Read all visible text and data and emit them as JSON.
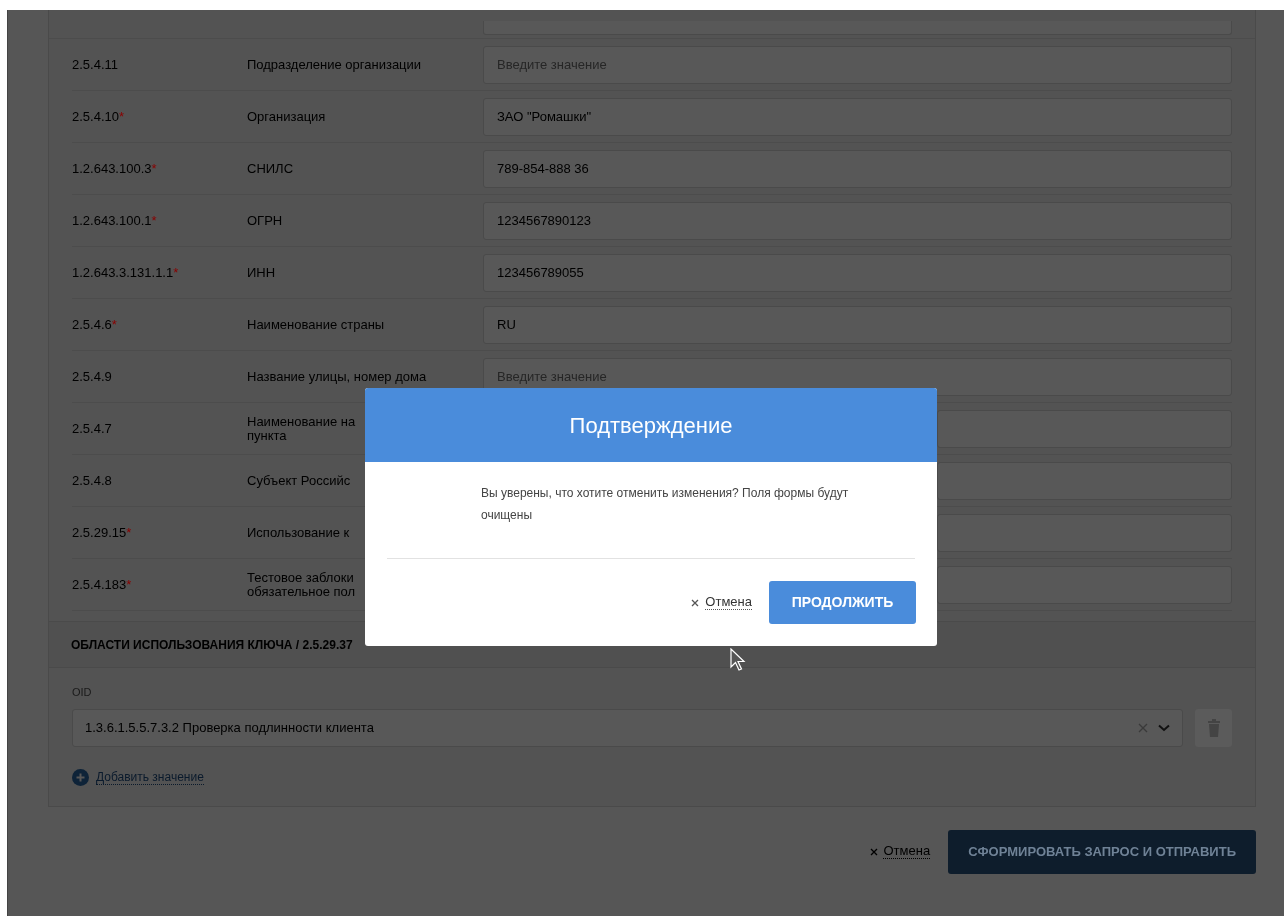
{
  "form_rows": [
    {
      "oid": "2.5.4.11",
      "label_lines": [
        "Подразделение организации"
      ],
      "field": {
        "placeholder": "Введите значение"
      }
    },
    {
      "oid": "2.5.4.10",
      "required_mark": "*",
      "label_lines": [
        "Организация"
      ],
      "field": {
        "value": "ЗАО \"Ромашки\""
      }
    },
    {
      "oid": "1.2.643.100.3",
      "required_mark": "*",
      "label_lines": [
        "СНИЛС"
      ],
      "field": {
        "value": "789-854-888 36"
      }
    },
    {
      "oid": "1.2.643.100.1",
      "required_mark": "*",
      "label_lines": [
        "ОГРН"
      ],
      "field": {
        "value": "1234567890123"
      }
    },
    {
      "oid": "1.2.643.3.131.1.1",
      "required_mark": "*",
      "label_lines": [
        "ИНН"
      ],
      "field": {
        "value": "123456789055"
      }
    },
    {
      "oid": "2.5.4.6",
      "required_mark": "*",
      "label_lines": [
        "Наименование страны"
      ],
      "field": {
        "value": "RU"
      }
    },
    {
      "oid": "2.5.4.9",
      "label_lines": [
        "Название улицы, номер дома"
      ],
      "field": {
        "placeholder": "Введите значение"
      }
    },
    {
      "oid": "2.5.4.7",
      "label_lines": [
        "Наименование на",
        "пункта"
      ]
    },
    {
      "oid": "2.5.4.8",
      "label_lines": [
        "Субъект Российс"
      ]
    },
    {
      "oid": "2.5.29.15",
      "required_mark": "*",
      "label_lines": [
        "Использование к"
      ]
    },
    {
      "oid": "2.5.4.183",
      "required_mark": "*",
      "label_lines": [
        "Тестовое заблоки",
        "обязательное пол"
      ]
    }
  ],
  "section": {
    "title": "ОБЛАСТИ ИСПОЛЬЗОВАНИЯ КЛЮЧА / 2.5.29.37"
  },
  "oid_field": {
    "label": "OID",
    "value": "1.3.6.1.5.5.7.3.2 Проверка подлинности клиента"
  },
  "add_link": "Добавить значение",
  "footer": {
    "cancel": "Отмена",
    "submit": "СФОРМИРОВАТЬ ЗАПРОС И ОТПРАВИТЬ"
  },
  "dialog": {
    "title": "Подтверждение",
    "message": "Вы уверены, что хотите отменить изменения? Поля формы будут очищены",
    "cancel": "Отмена",
    "confirm": "ПРОДОЛЖИТЬ"
  }
}
